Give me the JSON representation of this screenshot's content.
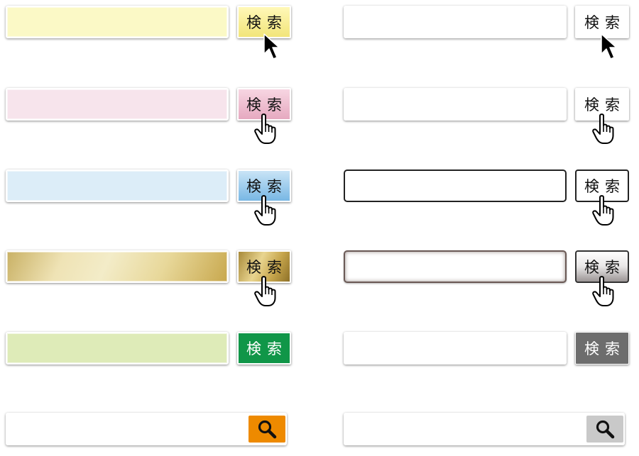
{
  "search_button_label": "検索",
  "icons": {
    "arrow": "arrow-pointer-icon",
    "hand": "hand-pointer-icon",
    "search": "magnifier-icon"
  },
  "colors": {
    "yellow_field": "#fbf9c6",
    "pink_field": "#f7e4ec",
    "blue_field": "#dcedf8",
    "gold_field": "#e8d89a",
    "green_field": "#deebb8",
    "green_button": "#109648",
    "orange_button": "#ee8a00",
    "gray_button": "#6d6d6d",
    "light_gray_button": "#c9c9c9"
  }
}
